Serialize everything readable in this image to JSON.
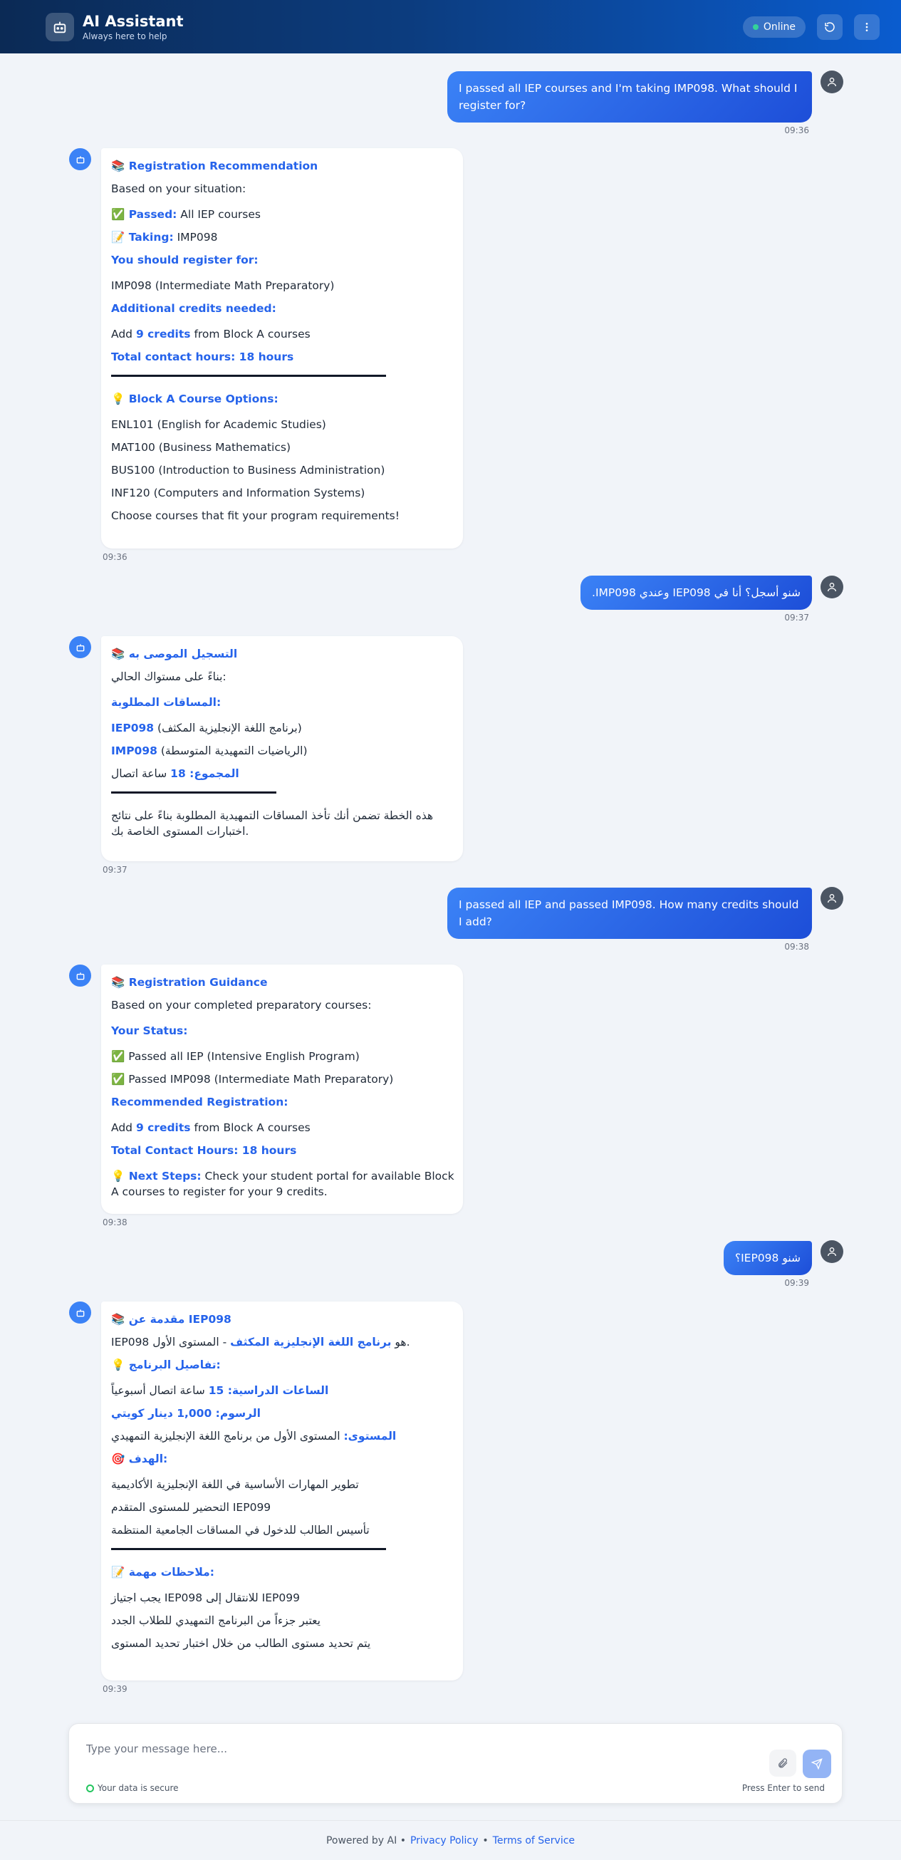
{
  "header": {
    "title": "AI Assistant",
    "subtitle": "Always here to help",
    "status": "Online"
  },
  "messages": {
    "m1": {
      "text": "I passed all IEP courses and I'm taking IMP098. What should I register for?",
      "time": "09:36"
    },
    "m2": {
      "title": "📚 Registration Recommendation",
      "intro": "Based on your situation:",
      "passed_label": "✅ Passed:",
      "passed_value": " All IEP courses",
      "taking_label": "📝 Taking:",
      "taking_value": " IMP098",
      "register_heading": "You should register for:",
      "register_item": "IMP098 (Intermediate Math Preparatory)",
      "credits_heading": "Additional credits needed:",
      "add_pre": "Add ",
      "add_credits": "9 credits",
      "add_post": " from Block A courses",
      "total": "Total contact hours: 18 hours",
      "options_heading": "💡 Block A Course Options:",
      "courses": [
        "ENL101 (English for Academic Studies)",
        "MAT100 (Business Mathematics)",
        "BUS100 (Introduction to Business Administration)",
        "INF120 (Computers and Information Systems)"
      ],
      "closing": "Choose courses that fit your program requirements!",
      "time": "09:36"
    },
    "m3": {
      "text": "شنو أسجل؟ أنا في IEP098 وعندي IMP098.",
      "time": "09:37"
    },
    "m4": {
      "title": "📚 التسجيل الموصى به",
      "intro": "بناءً على مستواك الحالي:",
      "required_heading": "المساقات المطلوبة:",
      "c1_code": "IEP098",
      "c1_name": " (برنامج اللغة الإنجليزية المكثف)",
      "c2_code": "IMP098",
      "c2_name": " (الرياضيات التمهيدية المتوسطة)",
      "total_label": "المجموع: 18",
      "total_value": " ساعة اتصال",
      "note": "هذه الخطة تضمن أنك تأخذ المساقات التمهيدية المطلوبة بناءً على نتائج اختبارات المستوى الخاصة بك.",
      "time": "09:37"
    },
    "m5": {
      "text": "I passed all IEP and passed IMP098. How many credits should I add?",
      "time": "09:38"
    },
    "m6": {
      "title": "📚 Registration Guidance",
      "intro": "Based on your completed preparatory courses:",
      "status_heading": "Your Status:",
      "status_1": "✅ Passed all IEP (Intensive English Program)",
      "status_2": "✅ Passed IMP098 (Intermediate Math Preparatory)",
      "rec_heading": "Recommended Registration:",
      "add_pre": "Add ",
      "add_credits": "9 credits",
      "add_post": " from Block A courses",
      "total": "Total Contact Hours: 18 hours",
      "next_label": "💡 Next Steps:",
      "next_text": " Check your student portal for available Block A courses to register for your 9 credits.",
      "time": "09:38"
    },
    "m7": {
      "text": "شنو IEP098؟",
      "time": "09:39"
    },
    "m8": {
      "title": "📚 مقدمة عن IEP098",
      "def_pre": "IEP098 هو ",
      "def_prog": "برنامج اللغة الإنجليزية المكثف",
      "def_post": " - المستوى الأول.",
      "details_heading": "💡 تفاصيل البرنامج:",
      "hours_label": "الساعات الدراسية: 15",
      "hours_value": " ساعة اتصال أسبوعياً",
      "fees_label": "الرسوم: 1,000 دينار كويتي",
      "level_label": "المستوى:",
      "level_value": " المستوى الأول من برنامج اللغة الإنجليزية التمهيدي",
      "goal_heading": "🎯 الهدف:",
      "goals": [
        "تطوير المهارات الأساسية في اللغة الإنجليزية الأكاديمية",
        "التحضير للمستوى المتقدم IEP099",
        "تأسيس الطالب للدخول في المساقات الجامعية المنتظمة"
      ],
      "notes_heading": "📝 ملاحظات مهمة:",
      "notes": [
        "يجب اجتياز IEP098 للانتقال إلى IEP099",
        "يعتبر جزءاً من البرنامج التمهيدي للطلاب الجدد",
        "يتم تحديد مستوى الطالب من خلال اختبار تحديد المستوى"
      ],
      "time": "09:39"
    }
  },
  "composer": {
    "placeholder": "Type your message here...",
    "secure": "Your data is secure",
    "hint": "Press Enter to send"
  },
  "footer": {
    "powered": "Powered by AI •",
    "privacy": "Privacy Policy",
    "sep": "•",
    "terms": "Terms of Service"
  }
}
